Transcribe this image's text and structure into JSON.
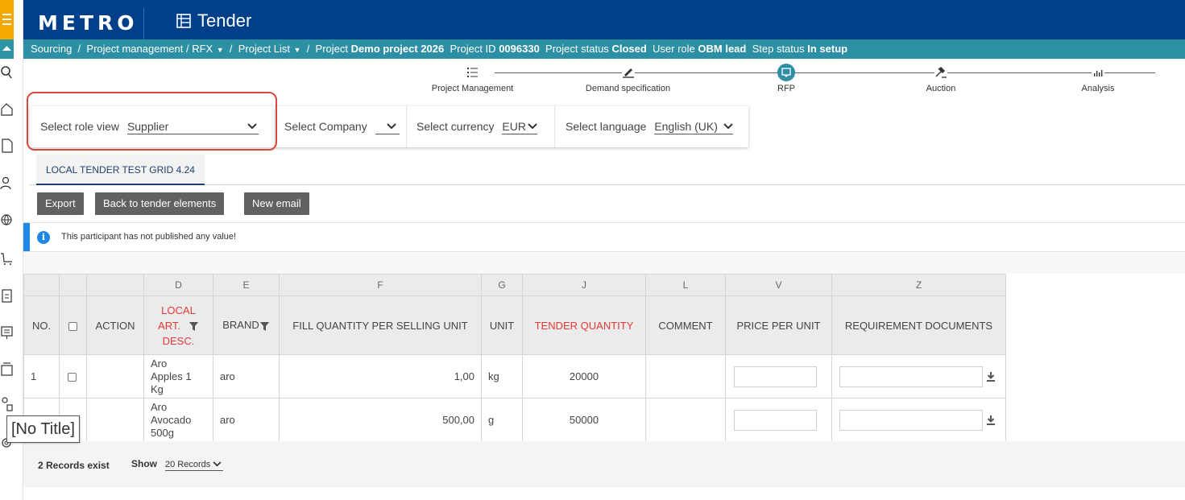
{
  "header": {
    "logo": "METRO",
    "app_title": "Tender"
  },
  "breadcrumb": {
    "items": [
      "Sourcing",
      "Project management / RFX",
      "Project List"
    ],
    "project_label": "Project",
    "project_name": "Demo project 2026",
    "project_id_label": "Project ID",
    "project_id": "0096330",
    "project_status_label": "Project status",
    "project_status": "Closed",
    "user_role_label": "User role",
    "user_role": "OBM lead",
    "step_status_label": "Step status",
    "step_status": "In setup"
  },
  "steps": [
    {
      "label": "Project Management"
    },
    {
      "label": "Demand specification"
    },
    {
      "label": "RFP",
      "active": true
    },
    {
      "label": "Auction"
    },
    {
      "label": "Analysis"
    }
  ],
  "selectors": {
    "role_label": "Select role view",
    "role_value": "Supplier",
    "company_label": "Select Company",
    "currency_label": "Select currency",
    "currency_value": "EUR",
    "language_label": "Select language",
    "language_value": "English (UK)"
  },
  "tab": {
    "label": "LOCAL TENDER TEST GRID 4.24"
  },
  "buttons": {
    "export": "Export",
    "back": "Back to tender elements",
    "new_email": "New email"
  },
  "info": {
    "icon": "info-icon",
    "message": "This participant has not published any value!"
  },
  "grid": {
    "letters": [
      "",
      "",
      "",
      "D",
      "E",
      "F",
      "G",
      "J",
      "L",
      "V",
      "Z"
    ],
    "headers": {
      "no": "NO.",
      "action": "ACTION",
      "local_desc_1": "LOCAL",
      "local_desc_2": "ART.",
      "local_desc_3": "DESC.",
      "brand": "BRAND",
      "fill_qty": "FILL QUANTITY PER SELLING UNIT",
      "unit": "UNIT",
      "tender_qty": "TENDER QUANTITY",
      "comment": "COMMENT",
      "price": "PRICE PER UNIT",
      "req_docs": "REQUIREMENT DOCUMENTS"
    },
    "rows": [
      {
        "no": "1",
        "desc_1": "Aro",
        "desc_2": "Apples 1",
        "desc_3": "Kg",
        "brand": "aro",
        "fill_qty": "1,00",
        "unit": "kg",
        "tender_qty": "20000",
        "comment": ""
      },
      {
        "no": "",
        "desc_1": "Aro",
        "desc_2": "Avocado",
        "desc_3": "500g",
        "brand": "aro",
        "fill_qty": "500,00",
        "unit": "g",
        "tender_qty": "50000",
        "comment": ""
      }
    ]
  },
  "footer": {
    "records": "2 Records exist",
    "show_label": "Show",
    "page_size": "20 Records"
  },
  "tooltip": "[No Title]",
  "colors": {
    "header": "#003f8a",
    "breadcrumb": "#2d8fa3",
    "accent": "#f5a800",
    "highlight": "#d9483c",
    "required_red": "#e53935",
    "button": "#616161"
  }
}
